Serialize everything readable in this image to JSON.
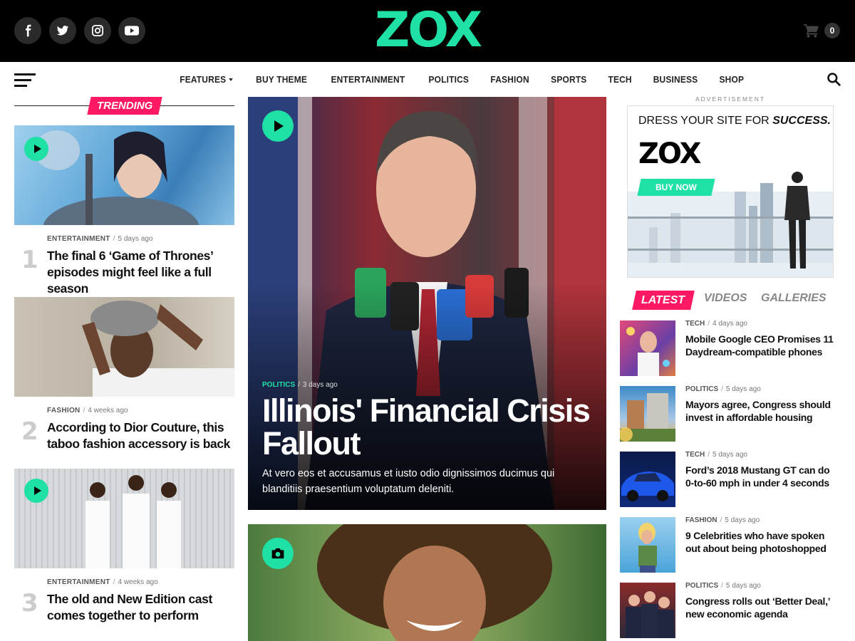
{
  "header": {
    "logo": "ZOX",
    "cart_count": "0",
    "social_icons": [
      "facebook-icon",
      "twitter-icon",
      "instagram-icon",
      "youtube-icon"
    ]
  },
  "nav": {
    "items": [
      {
        "label": "FEATURES"
      },
      {
        "label": "BUY THEME"
      },
      {
        "label": "ENTERTAINMENT"
      },
      {
        "label": "POLITICS"
      },
      {
        "label": "FASHION"
      },
      {
        "label": "SPORTS"
      },
      {
        "label": "TECH"
      },
      {
        "label": "BUSINESS"
      },
      {
        "label": "SHOP"
      }
    ]
  },
  "trending": {
    "label": "TRENDING",
    "items": [
      {
        "rank": "1",
        "category": "ENTERTAINMENT",
        "time": "5 days ago",
        "title": "The final 6 ‘Game of Thrones’ episodes might feel like a full season"
      },
      {
        "rank": "2",
        "category": "FASHION",
        "time": "4 weeks ago",
        "title": "According to Dior Couture, this taboo fashion accessory is back"
      },
      {
        "rank": "3",
        "category": "ENTERTAINMENT",
        "time": "4 weeks ago",
        "title": "The old and New Edition cast comes together to perform"
      }
    ]
  },
  "feature": {
    "category": "POLITICS",
    "time": "3 days ago",
    "title": "Illinois' Financial Crisis Fallout",
    "excerpt": "At vero eos et accusamus et iusto odio dignissimos ducimus qui blanditiis praesentium voluptatum deleniti."
  },
  "ad": {
    "label": "ADVERTISEMENT",
    "headline": "DRESS YOUR SITE FOR ",
    "headline_bold": "SUCCESS.",
    "logo": "ZOX",
    "button": "BUY NOW"
  },
  "latest": {
    "tabs": {
      "latest": "LATEST",
      "videos": "VIDEOS",
      "galleries": "GALLERIES"
    },
    "items": [
      {
        "category": "TECH",
        "time": "4 days ago",
        "title": "Mobile Google CEO Promises 11 Daydream-compatible phones"
      },
      {
        "category": "POLITICS",
        "time": "5 days ago",
        "title": "Mayors agree, Congress should invest in affordable housing"
      },
      {
        "category": "TECH",
        "time": "5 days ago",
        "title": "Ford’s 2018 Mustang GT can do 0-to-60 mph in under 4 seconds"
      },
      {
        "category": "FASHION",
        "time": "5 days ago",
        "title": "9 Celebrities who have spoken out about being photoshopped"
      },
      {
        "category": "POLITICS",
        "time": "5 days ago",
        "title": "Congress rolls out ‘Better Deal,’ new economic agenda"
      }
    ]
  },
  "colors": {
    "accent": "#1fe0a5",
    "tag": "#ff1962",
    "topbar": "#000000"
  }
}
